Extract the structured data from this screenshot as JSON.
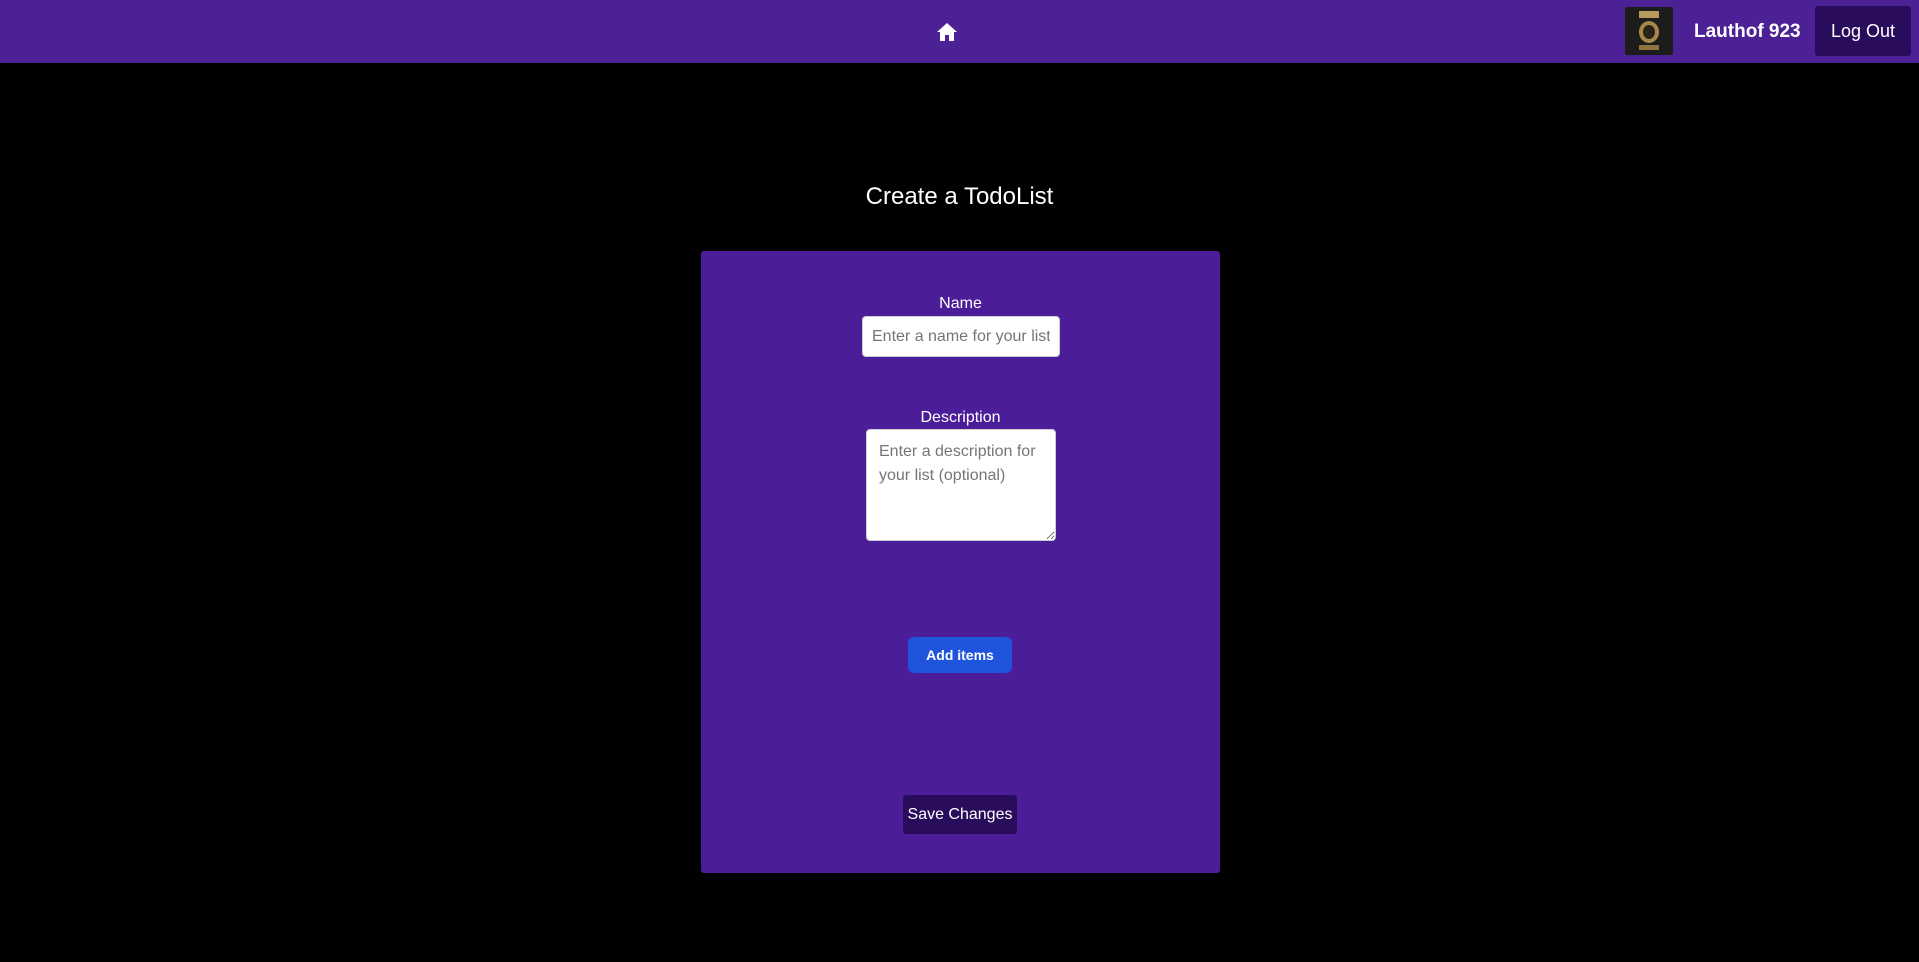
{
  "header": {
    "home_icon": "home-icon",
    "avatar_icon": "user-avatar",
    "username": "Lauthof 923",
    "logout_label": "Log Out"
  },
  "page": {
    "title": "Create a TodoList"
  },
  "form": {
    "name_label": "Name",
    "name_placeholder": "Enter a name for your list",
    "name_value": "",
    "description_label": "Description",
    "description_placeholder": "Enter a description for your list (optional)",
    "description_value": "",
    "add_items_label": "Add items",
    "save_label": "Save Changes"
  },
  "colors": {
    "header_bg": "#4c2196",
    "card_bg": "#4c1d99",
    "dark_button": "#2a0c5c",
    "primary_button": "#1f55dd",
    "page_bg": "#000000"
  }
}
